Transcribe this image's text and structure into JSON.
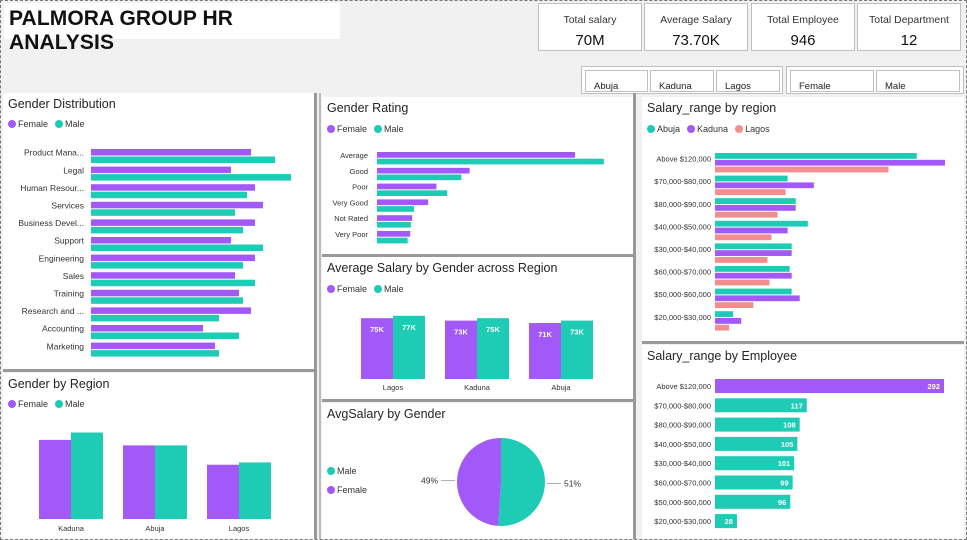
{
  "header": {
    "title": "PALMORA GROUP HR ANALYSIS"
  },
  "kpis": [
    {
      "label": "Total salary",
      "value": "70M"
    },
    {
      "label": "Average Salary",
      "value": "73.70K"
    },
    {
      "label": "Total Employee",
      "value": "946"
    },
    {
      "label": "Total Department",
      "value": "12"
    }
  ],
  "region_slicer": {
    "options": [
      "Abuja",
      "Kaduna",
      "Lagos"
    ]
  },
  "gender_slicer": {
    "options": [
      "Female",
      "Male"
    ]
  },
  "colors": {
    "female": "#a259f7",
    "male": "#1ecbb4",
    "abuja": "#1ecbb4",
    "kaduna": "#a259f7",
    "lagos": "#f28e8e",
    "employee_top": "#a259f7",
    "employee": "#1ecbb4"
  },
  "panels": {
    "gender_distribution": {
      "title": "Gender Distribution",
      "legend": [
        "Female",
        "Male"
      ]
    },
    "gender_rating": {
      "title": "Gender Rating",
      "legend": [
        "Female",
        "Male"
      ]
    },
    "salary_region": {
      "title": "Salary_range by region",
      "legend": [
        "Abuja",
        "Kaduna",
        "Lagos"
      ]
    },
    "avg_salary_region": {
      "title": "Average Salary by Gender across Region",
      "legend": [
        "Female",
        "Male"
      ]
    },
    "salary_employee": {
      "title": "Salary_range by Employee"
    },
    "gender_region": {
      "title": "Gender by Region",
      "legend": [
        "Female",
        "Male"
      ]
    },
    "avg_salary_gender": {
      "title": "AvgSalary by Gender",
      "legend": [
        "Male",
        "Female"
      ]
    }
  },
  "chart_data": [
    {
      "id": "gender_distribution",
      "type": "bar",
      "orientation": "horizontal",
      "title": "Gender Distribution",
      "categories": [
        "Product Mana...",
        "Legal",
        "Human Resour...",
        "Services",
        "Business Devel...",
        "Support",
        "Engineering",
        "Sales",
        "Training",
        "Research and ...",
        "Accounting",
        "Marketing"
      ],
      "series": [
        {
          "name": "Female",
          "values": [
            40,
            35,
            41,
            43,
            41,
            35,
            41,
            36,
            37,
            40,
            28,
            31
          ]
        },
        {
          "name": "Male",
          "values": [
            46,
            50,
            39,
            36,
            38,
            43,
            38,
            41,
            38,
            32,
            37,
            32
          ]
        }
      ],
      "xlim": [
        0,
        50
      ]
    },
    {
      "id": "gender_rating",
      "type": "bar",
      "orientation": "horizontal",
      "title": "Gender Rating",
      "categories": [
        "Average",
        "Good",
        "Poor",
        "Very Good",
        "Not Rated",
        "Very Poor"
      ],
      "series": [
        {
          "name": "Female",
          "values": [
            310,
            145,
            93,
            80,
            55,
            52
          ]
        },
        {
          "name": "Male",
          "values": [
            355,
            132,
            110,
            58,
            53,
            48
          ]
        }
      ],
      "xlim": [
        0,
        360
      ]
    },
    {
      "id": "salary_region",
      "type": "bar",
      "orientation": "horizontal",
      "title": "Salary_range by region",
      "categories": [
        "Above $120,000",
        "$70,000-$80,000",
        "$80,000-$90,000",
        "$40,000-$50,000",
        "$30,000-$40,000",
        "$60,000-$70,000",
        "$50,000-$60,000",
        "$20,000-$30,000"
      ],
      "series": [
        {
          "name": "Abuja",
          "values": [
            100,
            36,
            40,
            46,
            38,
            37,
            38,
            9
          ]
        },
        {
          "name": "Kaduna",
          "values": [
            114,
            49,
            40,
            36,
            38,
            38,
            42,
            13
          ]
        },
        {
          "name": "Lagos",
          "values": [
            86,
            35,
            31,
            28,
            26,
            27,
            19,
            7
          ]
        }
      ],
      "xlim": [
        0,
        114
      ]
    },
    {
      "id": "avg_salary_region",
      "type": "bar",
      "title": "Average Salary by Gender across Region",
      "categories": [
        "Lagos",
        "Kaduna",
        "Abuja"
      ],
      "series": [
        {
          "name": "Female",
          "values": [
            75,
            73,
            71
          ],
          "labels": [
            "75K",
            "73K",
            "71K"
          ]
        },
        {
          "name": "Male",
          "values": [
            77,
            75,
            73
          ],
          "labels": [
            "77K",
            "75K",
            "73K"
          ]
        }
      ],
      "ylim": [
        0,
        80
      ]
    },
    {
      "id": "salary_employee",
      "type": "bar",
      "orientation": "horizontal",
      "title": "Salary_range by Employee",
      "categories": [
        "Above $120,000",
        "$70,000-$80,000",
        "$80,000-$90,000",
        "$40,000-$50,000",
        "$30,000-$40,000",
        "$60,000-$70,000",
        "$50,000-$60,000",
        "$20,000-$30,000"
      ],
      "values": [
        292,
        117,
        108,
        105,
        101,
        99,
        96,
        28
      ],
      "xlim": [
        0,
        292
      ]
    },
    {
      "id": "gender_region",
      "type": "bar",
      "title": "Gender by Region",
      "categories": [
        "Kaduna",
        "Abuja",
        "Lagos"
      ],
      "series": [
        {
          "name": "Female",
          "values": [
            172,
            160,
            118
          ]
        },
        {
          "name": "Male",
          "values": [
            188,
            160,
            123
          ]
        }
      ],
      "ylim": [
        0,
        200
      ]
    },
    {
      "id": "avg_salary_gender",
      "type": "pie",
      "title": "AvgSalary by Gender",
      "slices": [
        {
          "name": "Male",
          "value": 51,
          "label": "51%"
        },
        {
          "name": "Female",
          "value": 49,
          "label": "49%"
        }
      ]
    }
  ]
}
